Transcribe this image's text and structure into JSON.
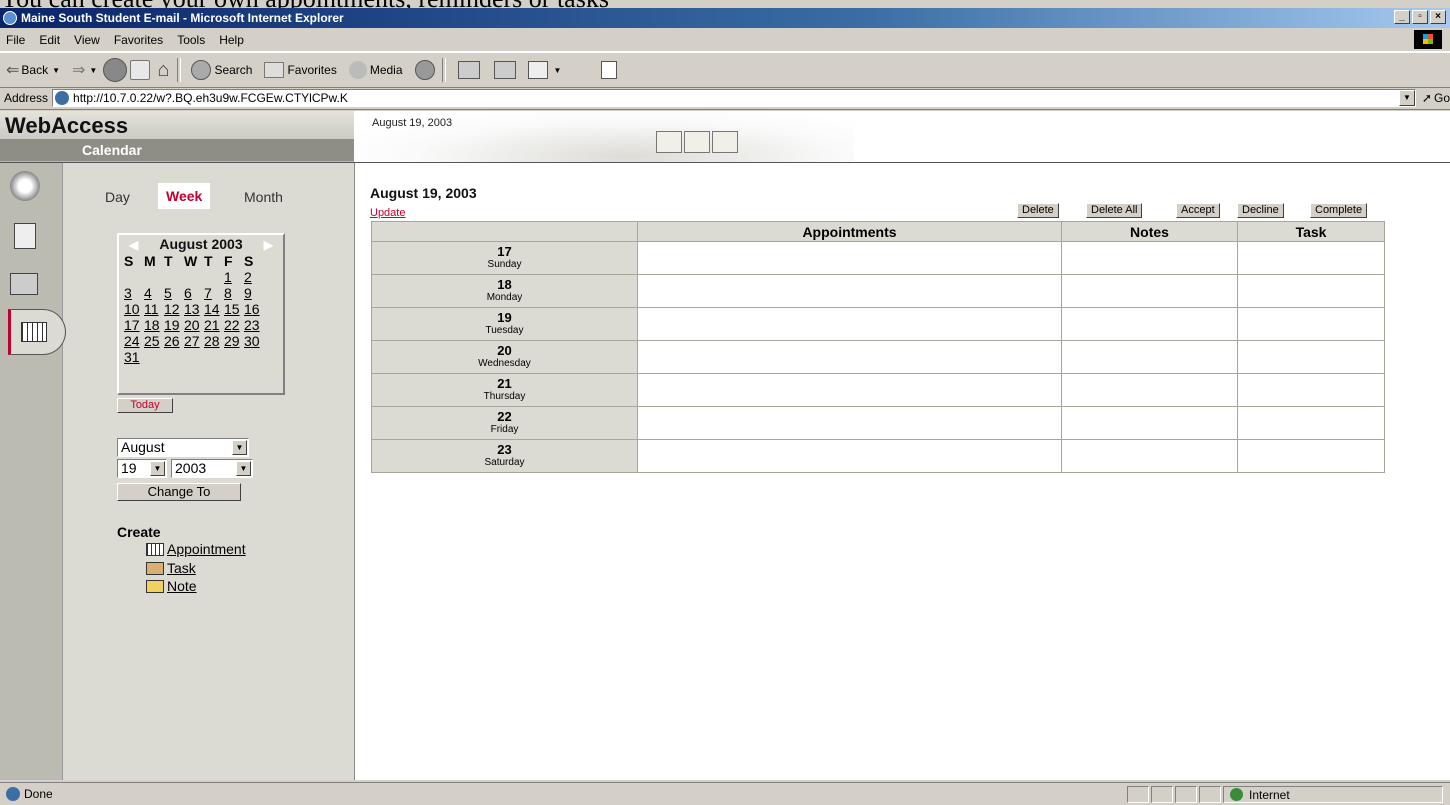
{
  "caption": "You can create your own appointments, reminders or tasks",
  "window": {
    "title": "Maine South Student E-mail - Microsoft Internet Explorer"
  },
  "menu": [
    "File",
    "Edit",
    "View",
    "Favorites",
    "Tools",
    "Help"
  ],
  "toolbar": {
    "back": "Back",
    "search": "Search",
    "favorites": "Favorites",
    "media": "Media"
  },
  "address": {
    "label": "Address",
    "url": "http://10.7.0.22/w?.BQ.eh3u9w.FCGEw.CTYlCPw.K",
    "go": "Go"
  },
  "header": {
    "app": "WebAccess",
    "section": "Calendar",
    "date": "August 19, 2003"
  },
  "views": {
    "day": "Day",
    "week": "Week",
    "month": "Month",
    "active": "Week"
  },
  "mini_calendar": {
    "title": "August 2003",
    "weekdays": [
      "S",
      "M",
      "T",
      "W",
      "T",
      "F",
      "S"
    ],
    "lead_blanks": 5,
    "dates": [
      "1",
      "2",
      "3",
      "4",
      "5",
      "6",
      "7",
      "8",
      "9",
      "10",
      "11",
      "12",
      "13",
      "14",
      "15",
      "16",
      "17",
      "18",
      "19",
      "20",
      "21",
      "22",
      "23",
      "24",
      "25",
      "26",
      "27",
      "28",
      "29",
      "30",
      "31"
    ],
    "today": "Today"
  },
  "change": {
    "month": "August",
    "day": "19",
    "year": "2003",
    "button": "Change To"
  },
  "create": {
    "title": "Create",
    "items": [
      "Appointment",
      "Task",
      "Note"
    ]
  },
  "main": {
    "date": "August 19, 2003",
    "update": "Update",
    "buttons": [
      "Delete",
      "Delete All",
      "Accept",
      "Decline",
      "Complete"
    ],
    "columns": [
      "Appointments",
      "Notes",
      "Task"
    ],
    "days": [
      {
        "num": "17",
        "name": "Sunday"
      },
      {
        "num": "18",
        "name": "Monday"
      },
      {
        "num": "19",
        "name": "Tuesday"
      },
      {
        "num": "20",
        "name": "Wednesday"
      },
      {
        "num": "21",
        "name": "Thursday"
      },
      {
        "num": "22",
        "name": "Friday"
      },
      {
        "num": "23",
        "name": "Saturday"
      }
    ]
  },
  "status": {
    "left": "Done",
    "zone": "Internet"
  },
  "colors": {
    "accent": "#c0002e",
    "titlebar": "#0a246a"
  }
}
